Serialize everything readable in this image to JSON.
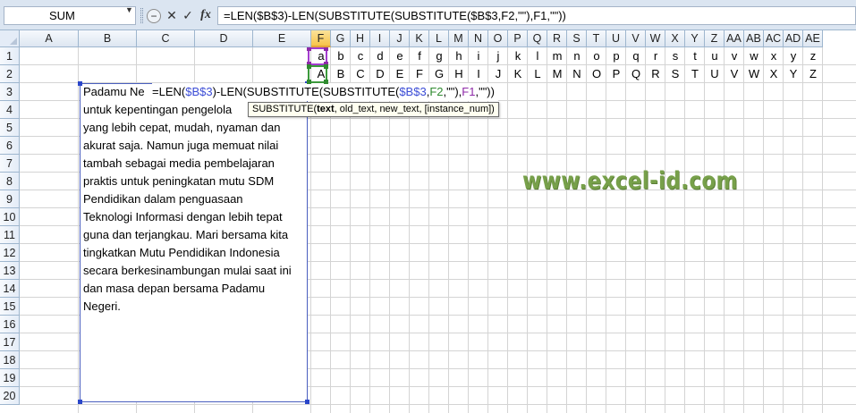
{
  "formula_bar": {
    "name_box": "SUM",
    "name_box_arrow": "▼",
    "cancel_symbol": "✕",
    "enter_symbol": "✓",
    "fx_label": "fx",
    "formula": "=LEN($B$3)-LEN(SUBSTITUTE(SUBSTITUTE($B$3,F2,\"\"),F1,\"\"))"
  },
  "columns": [
    "A",
    "B",
    "C",
    "D",
    "E",
    "F",
    "G",
    "H",
    "I",
    "J",
    "K",
    "L",
    "M",
    "N",
    "O",
    "P",
    "Q",
    "R",
    "S",
    "T",
    "U",
    "V",
    "W",
    "X",
    "Y",
    "Z",
    "AA",
    "AB",
    "AC",
    "AD",
    "AE"
  ],
  "rows": [
    "1",
    "2",
    "3",
    "4",
    "5",
    "6",
    "7",
    "8",
    "9",
    "10",
    "11",
    "12",
    "13",
    "14",
    "15",
    "16",
    "17",
    "18",
    "19",
    "20"
  ],
  "active_column": "F",
  "row1_values": [
    "a",
    "b",
    "c",
    "d",
    "e",
    "f",
    "g",
    "h",
    "i",
    "j",
    "k",
    "l",
    "m",
    "n",
    "o",
    "p",
    "q",
    "r",
    "s",
    "t",
    "u",
    "v",
    "w",
    "x",
    "y",
    "z"
  ],
  "row2_values": [
    "A",
    "B",
    "C",
    "D",
    "E",
    "F",
    "G",
    "H",
    "I",
    "J",
    "K",
    "L",
    "M",
    "N",
    "O",
    "P",
    "Q",
    "R",
    "S",
    "T",
    "U",
    "V",
    "W",
    "X",
    "Y",
    "Z"
  ],
  "paragraph_lines": [
    "Padamu Ne",
    "untuk kepentingan pengelola",
    "yang lebih cepat, mudah, nyaman dan",
    "akurat saja. Namun juga memuat nilai",
    "tambah sebagai media pembelajaran",
    "praktis untuk peningkatan mutu SDM",
    "Pendidikan dalam penguasaan",
    "Teknologi Informasi dengan lebih tepat",
    "guna dan terjangkau. Mari bersama kita",
    "tingkatkan Mutu Pendidikan Indonesia",
    "secara berkesinambungan mulai saat ini",
    "dan masa depan bersama Padamu",
    "Negeri."
  ],
  "in_cell_formula": {
    "p1": "=LEN(",
    "ref1": "$B$3",
    "p2": ")-LEN(SUBSTITUTE(SUBSTITUTE(",
    "ref2": "$B$3",
    "p3": ",",
    "ref3": "F2",
    "p4": ",\"\"),",
    "ref4": "F1",
    "p5": ",\"\"))"
  },
  "tooltip": {
    "func": "SUBSTITUTE(",
    "arg1": "text",
    "rest": ", old_text, new_text, [instance_num])"
  },
  "watermark": "www.excel-id.com",
  "colors": {
    "ref_blue": "#3b4cd6",
    "ref_green": "#2f8a2f",
    "ref_purple": "#8e2aa8",
    "watermark": "#77a04a"
  }
}
